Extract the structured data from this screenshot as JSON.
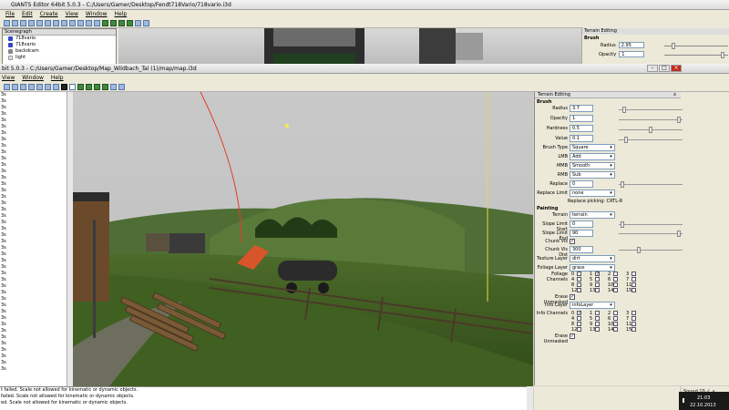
{
  "back_window": {
    "title": "GIANTS Editor 64bit 5.0.3 - C:/Users/Gamer/Desktop/Fendt718Vario/718vario.i3d",
    "menu": [
      "File",
      "Edit",
      "Create",
      "View",
      "Window",
      "Help"
    ],
    "scenegraph": {
      "title": "Scenegraph",
      "nodes": [
        "718vario",
        "718vario",
        "backdcam",
        "light"
      ]
    },
    "terrain_panel": {
      "title": "Terrain Editing",
      "brush_label": "Brush",
      "radius_label": "Radius",
      "radius_value": "2.95",
      "opacity_label": "Opacity",
      "opacity_value": "1"
    }
  },
  "front_window": {
    "title": "bit 5.0.3 - C:/Users/Gamer/Desktop/Map_Wildbach_Tal (1)/map/map.i3d",
    "menu": [
      "View",
      "Window",
      "Help"
    ]
  },
  "left_panel": {
    "lines": [
      "3s",
      "3s",
      "3s",
      "3s",
      "3s",
      "3s",
      "3s",
      "3s",
      "3s",
      "3s",
      "3s",
      "3s",
      "3s",
      "3s",
      "3s",
      "3s",
      "3s",
      "3s",
      "3s",
      "3s",
      "3s",
      "3s",
      "3s",
      "3s",
      "3s",
      "3s",
      "3s",
      "3s",
      "3s",
      "3s",
      "3s",
      "3s",
      "3s",
      "3s",
      "3s",
      "3s",
      "3s",
      "3s",
      "3s",
      "3s",
      "3s",
      "3s",
      "3s",
      "3s"
    ]
  },
  "terrain_editing": {
    "title": "Terrain Editing",
    "close": "x",
    "brush": {
      "section": "Brush",
      "radius_label": "Radius",
      "radius_value": "3.7",
      "opacity_label": "Opacity",
      "opacity_value": "1",
      "hardness_label": "Hardness",
      "hardness_value": "0.5",
      "value_label": "Value",
      "value_value": "0.1",
      "brush_type_label": "Brush Type",
      "brush_type_value": "Square",
      "lmb_label": "LMB",
      "lmb_value": "Add",
      "mmb_label": "MMB",
      "mmb_value": "Smooth",
      "rmb_label": "RMB",
      "rmb_value": "Sub",
      "replace_label": "Replace",
      "replace_value": "0",
      "replace_limit_label": "Replace Limit",
      "replace_limit_value": "none",
      "replace_hint": "Replace picking: CRTL-R"
    },
    "painting": {
      "section": "Painting",
      "terrain_label": "Terrain",
      "terrain_value": "terrain",
      "slope_start_label": "Slope Limit Start",
      "slope_start_value": "0",
      "slope_end_label": "Slope Limit End",
      "slope_end_value": "90",
      "chunk_vis_label": "Chunk Vis",
      "chunk_vis_dist_label": "Chunk Vis Dist",
      "chunk_vis_dist_value": "300",
      "texture_layer_label": "Texture Layer",
      "texture_layer_value": "dirt",
      "foliage_layer_label": "Foliage Layer",
      "foliage_layer_value": "grass",
      "foliage_channels_label": "Foliage Channels",
      "channel_numbers": [
        "0",
        "1",
        "2",
        "3",
        "4",
        "5",
        "6",
        "7",
        "8",
        "9",
        "10",
        "11",
        "12",
        "13",
        "14",
        "15"
      ],
      "erase_unmasked_label": "Erase Unmasked",
      "info_layer_label": "Info Layer",
      "info_layer_value": "infoLayer",
      "info_channels_label": "Info Channels",
      "erase_unmasked_label_2": "Erase Unmasked"
    }
  },
  "console": {
    "lines": [
      "t failed. Scale not allowed for kinematic or dynamic objects.",
      "failed. Scale not allowed for kinematic or dynamic objects.",
      "ed. Scale not allowed for kinematic or dynamic objects."
    ]
  },
  "status": {
    "value": "Sound 10 ∠ ∨",
    "tray_time": "21:03",
    "tray_date": "22.10.2013"
  }
}
